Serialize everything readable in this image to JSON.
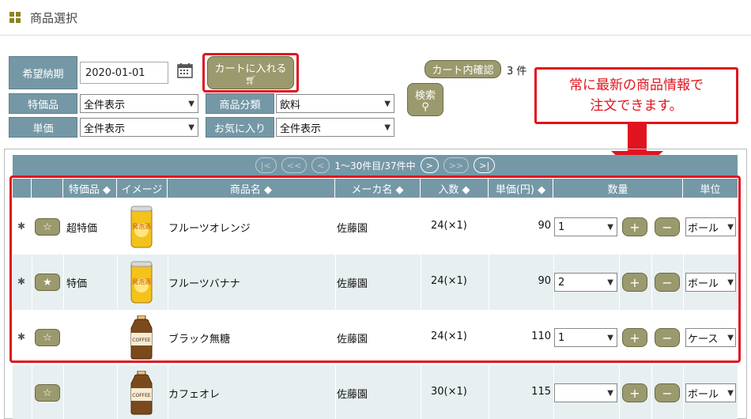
{
  "page_title": "商品選択",
  "filters": {
    "delivery_label": "希望納期",
    "delivery_value": "2020-01-01",
    "special_label": "特価品",
    "special_value": "全件表示",
    "unit_price_label": "単価",
    "unit_price_value": "全件表示",
    "category_label": "商品分類",
    "category_value": "飲料",
    "favorite_label": "お気に入り",
    "favorite_value": "全件表示"
  },
  "buttons": {
    "add_to_cart": "カートに入れる",
    "search": "検索",
    "cart_check": "カート内確認",
    "cart_count": "3 件"
  },
  "callout": {
    "line1": "常に最新の商品情報で",
    "line2": "注文できます。"
  },
  "pager": {
    "first": "|<",
    "prev_page": "<<",
    "prev": "<",
    "info": "1～30件目/37件中",
    "next": ">",
    "next_page": ">>",
    "last": ">|"
  },
  "columns": {
    "special": "特価品 ◆",
    "image": "イメージ",
    "name": "商品名 ◆",
    "maker": "メーカ名 ◆",
    "qty_per": "入数 ◆",
    "unit_price": "単価(円) ◆",
    "quantity": "数量",
    "unit": "単位"
  },
  "rows": [
    {
      "star": "☆",
      "special": "超特価",
      "name": "フルーツオレンジ",
      "maker": "佐藤園",
      "qty_per": "24(×1)",
      "price": "90",
      "qty": "1",
      "unit": "ボール",
      "can_label": "発泡酒",
      "can_color": "#f4c21b",
      "asterisk": "✱"
    },
    {
      "star": "★",
      "special": "特価",
      "name": "フルーツバナナ",
      "maker": "佐藤園",
      "qty_per": "24(×1)",
      "price": "90",
      "qty": "2",
      "unit": "ボール",
      "can_label": "発泡酒",
      "can_color": "#f4c21b",
      "asterisk": "✱"
    },
    {
      "star": "☆",
      "special": "",
      "name": "ブラック無糖",
      "maker": "佐藤園",
      "qty_per": "24(×1)",
      "price": "110",
      "qty": "1",
      "unit": "ケース",
      "can_label": "COFFEE",
      "can_color": "#7a4a1d",
      "asterisk": "✱"
    },
    {
      "star": "☆",
      "special": "",
      "name": "カフェオレ",
      "maker": "佐藤園",
      "qty_per": "30(×1)",
      "price": "115",
      "qty": "",
      "unit": "ボール",
      "can_label": "COFFEE",
      "can_color": "#7a4a1d",
      "asterisk": ""
    }
  ],
  "colors": {
    "accent_red": "#e0141e",
    "header_blue": "#7598a6",
    "button_olive": "#9b9a6e"
  }
}
